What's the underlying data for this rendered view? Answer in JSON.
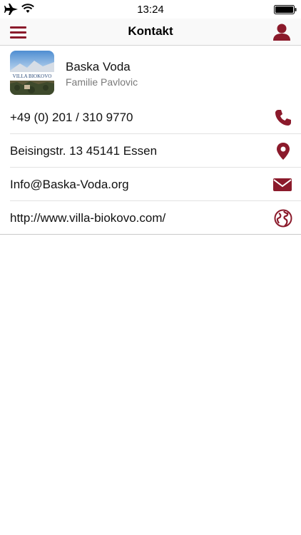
{
  "status_bar": {
    "time": "13:24"
  },
  "nav": {
    "title": "Kontakt"
  },
  "header": {
    "name": "Baska Voda",
    "subtitle": "Familie Pavlovic",
    "logo_text": "VILLA BIOKOVO"
  },
  "contacts": [
    {
      "type": "phone",
      "text": "+49 (0) 201 / 310 9770",
      "icon": "phone-icon"
    },
    {
      "type": "address",
      "text": "Beisingstr. 13 45141 Essen",
      "icon": "location-pin-icon"
    },
    {
      "type": "email",
      "text": "Info@Baska-Voda.org",
      "icon": "mail-icon"
    },
    {
      "type": "website",
      "text": "http://www.villa-biokovo.com/",
      "icon": "globe-icon"
    }
  ],
  "colors": {
    "accent": "#8b1a2b",
    "separator": "#e2e2e2"
  }
}
